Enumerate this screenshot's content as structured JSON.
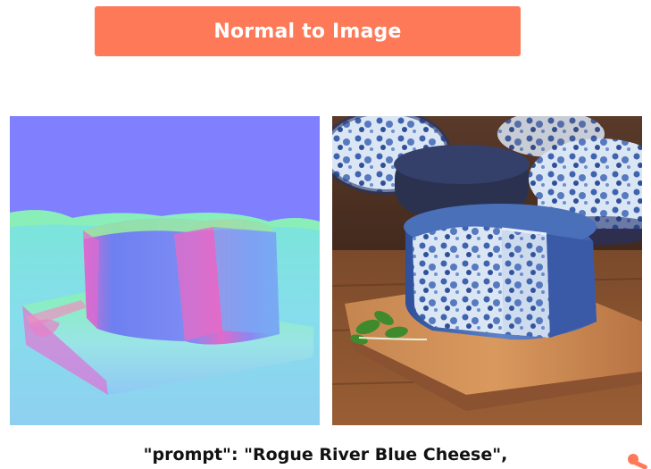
{
  "header": {
    "title": "Normal to Image"
  },
  "images": {
    "normal_map": {
      "icon": "normal-map-image"
    },
    "photo": {
      "icon": "blue-cheese-photo"
    }
  },
  "caption": {
    "text": "\"prompt\": \"Rogue River Blue Cheese\","
  },
  "colors": {
    "accent": "#fd7957",
    "normal_bg": "#8080ff",
    "wood": "#b07040"
  }
}
